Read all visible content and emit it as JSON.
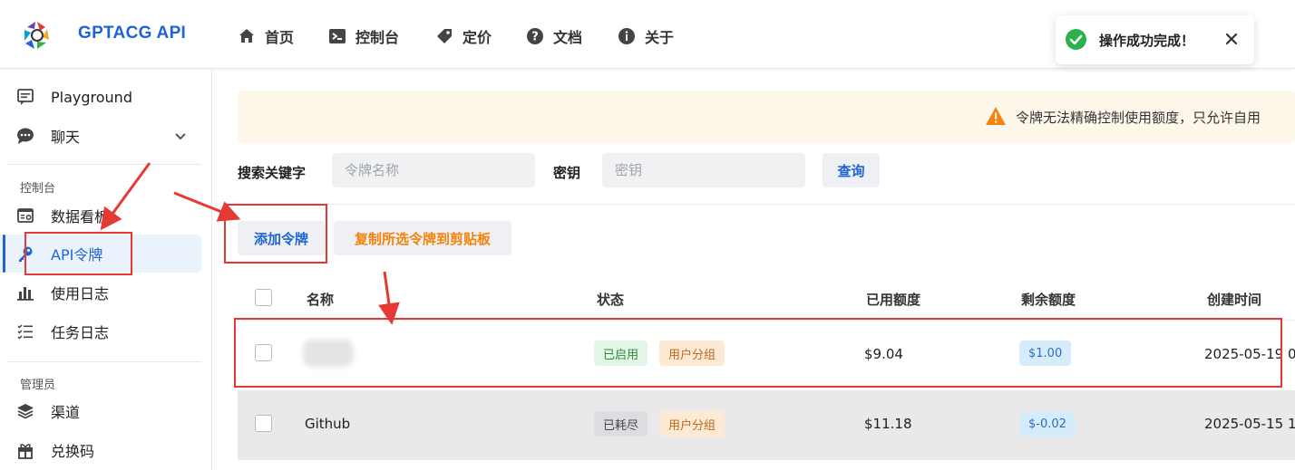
{
  "header": {
    "brand": "GPTACG API",
    "nav": [
      {
        "label": "首页",
        "icon": "home-icon"
      },
      {
        "label": "控制台",
        "icon": "terminal-icon"
      },
      {
        "label": "定价",
        "icon": "tag-icon"
      },
      {
        "label": "文档",
        "icon": "help-icon"
      },
      {
        "label": "关于",
        "icon": "info-icon"
      }
    ]
  },
  "toast": {
    "message": "操作成功完成！"
  },
  "sidebar": {
    "items_top": [
      {
        "label": "Playground",
        "icon": "chat-square-icon"
      },
      {
        "label": "聊天",
        "icon": "chat-bubble-icon"
      }
    ],
    "section_console": "控制台",
    "items_console": [
      {
        "label": "数据看板",
        "icon": "dashboard-icon"
      },
      {
        "label": "API令牌",
        "icon": "key-icon"
      },
      {
        "label": "使用日志",
        "icon": "bar-chart-icon"
      },
      {
        "label": "任务日志",
        "icon": "task-list-icon"
      }
    ],
    "section_admin": "管理员",
    "items_admin": [
      {
        "label": "渠道",
        "icon": "layers-icon"
      },
      {
        "label": "兑换码",
        "icon": "gift-icon"
      }
    ]
  },
  "banner": {
    "text": "令牌无法精确控制使用额度，只允许自用"
  },
  "search": {
    "keyword_label": "搜索关键字",
    "keyword_placeholder": "令牌名称",
    "key_label": "密钥",
    "key_placeholder": "密钥",
    "query_button": "查询"
  },
  "actions": {
    "add_token": "添加令牌",
    "copy_selected": "复制所选令牌到剪贴板"
  },
  "table": {
    "columns": [
      "名称",
      "状态",
      "已用额度",
      "剩余额度",
      "创建时间"
    ],
    "rows": [
      {
        "name": "",
        "status": "已启用",
        "group": "用户分组",
        "used": "$9.04",
        "remaining": "$1.00",
        "created": "2025-05-19 0"
      },
      {
        "name": "Github",
        "status": "已耗尽",
        "group": "用户分组",
        "used": "$11.18",
        "remaining": "$-0.02",
        "created": "2025-05-15 1"
      }
    ]
  },
  "colors": {
    "accent": "#1f63d6",
    "annotation": "#e53935",
    "success": "#2bb24c",
    "warning": "#f5820b"
  }
}
